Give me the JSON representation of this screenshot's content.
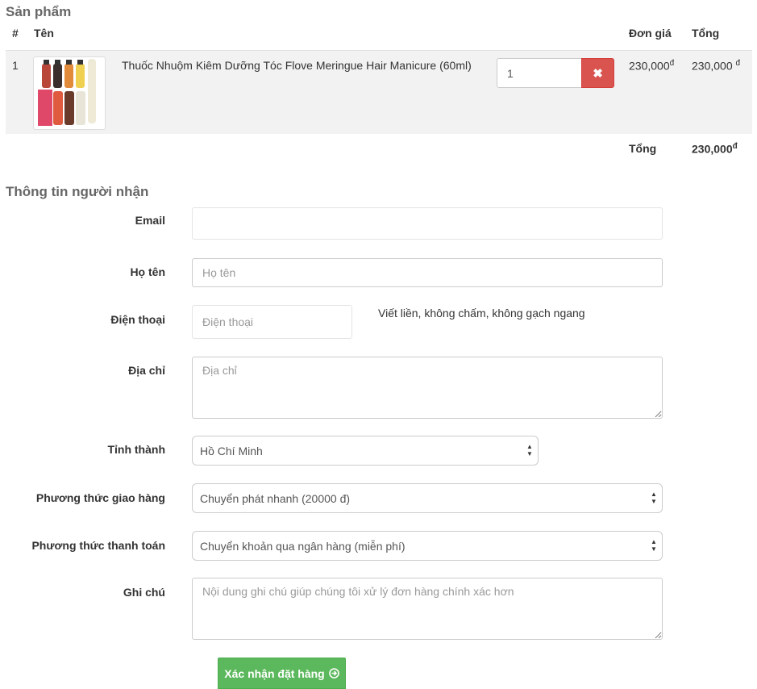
{
  "products_section": {
    "title": "Sản phẩm",
    "headers": {
      "index": "#",
      "name": "Tên",
      "unit_price": "Đơn giá",
      "total": "Tổng"
    },
    "items": [
      {
        "index": "1",
        "name": "Thuốc Nhuộm Kiêm Dưỡng Tóc Flove Meringue Hair Manicure (60ml)",
        "quantity": "1",
        "unit_price": "230,000",
        "currency": "đ",
        "line_total": "230,000",
        "remove_icon": "close-icon"
      }
    ],
    "grand_total_label": "Tổng",
    "grand_total": "230,000",
    "currency": "đ"
  },
  "recipient_section": {
    "title": "Thông tin người nhận",
    "email": {
      "label": "Email",
      "value": "",
      "placeholder": ""
    },
    "fullname": {
      "label": "Họ tên",
      "value": "",
      "placeholder": "Họ tên"
    },
    "phone": {
      "label": "Điện thoại",
      "value": "",
      "placeholder": "Điện thoại",
      "help": "Viết liền, không chấm, không gạch ngang"
    },
    "address": {
      "label": "Địa chỉ",
      "value": "",
      "placeholder": "Địa chỉ"
    },
    "city": {
      "label": "Tỉnh thành",
      "selected": "Hồ Chí Minh"
    },
    "shipping": {
      "label": "Phương thức giao hàng",
      "selected": "Chuyển phát nhanh (20000 đ)"
    },
    "payment": {
      "label": "Phương thức thanh toán",
      "selected": "Chuyển khoản qua ngân hàng (miễn phí)"
    },
    "note": {
      "label": "Ghi chú",
      "value": "",
      "placeholder": "Nội dung ghi chú giúp chúng tôi xử lý đơn hàng chính xác hơn"
    },
    "submit_label": "Xác nhận đặt hàng",
    "submit_icon": "arrow-circle-right-icon"
  },
  "colors": {
    "danger": "#d9534f",
    "success": "#5cb85c",
    "row_background": "#f2f2f2",
    "section_title": "#666666"
  }
}
